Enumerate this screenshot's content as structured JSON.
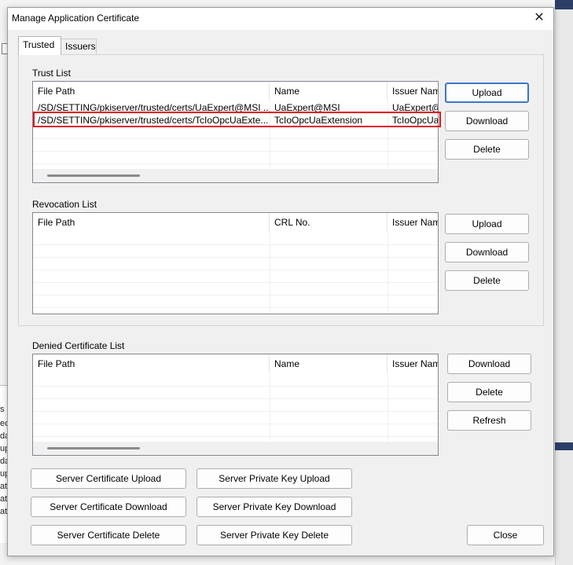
{
  "dialog": {
    "title": "Manage Application Certificate",
    "close_icon": "close-icon",
    "close_glyph": "✕"
  },
  "background": {
    "left_fragments": [
      "s",
      "ec",
      "da",
      "up",
      "da",
      "up",
      "ate",
      "ate",
      "ate"
    ]
  },
  "tabs": [
    {
      "label": "Trusted",
      "active": true
    },
    {
      "label": "Issuers",
      "active": false
    }
  ],
  "trust_list": {
    "label": "Trust List",
    "columns": [
      "File Path",
      "Name",
      "Issuer Nam"
    ],
    "rows": [
      {
        "file_path": "/SD/SETTING/pkiserver/trusted/certs/UaExpert@MSI ...",
        "name": "UaExpert@MSI",
        "issuer": "UaExpert@I"
      },
      {
        "file_path": "/SD/SETTING/pkiserver/trusted/certs/TcIoOpcUaExte...",
        "name": "TcIoOpcUaExtension",
        "issuer": "TcIoOpcUa",
        "highlighted": true
      }
    ],
    "buttons": {
      "upload": "Upload",
      "download": "Download",
      "delete": "Delete"
    }
  },
  "revocation_list": {
    "label": "Revocation List",
    "columns": [
      "File Path",
      "CRL No.",
      "Issuer Nam"
    ],
    "rows": [],
    "buttons": {
      "upload": "Upload",
      "download": "Download",
      "delete": "Delete"
    }
  },
  "denied_list": {
    "label": "Denied Certificate List",
    "columns": [
      "File Path",
      "Name",
      "Issuer Nam"
    ],
    "rows": [],
    "buttons": {
      "download": "Download",
      "delete": "Delete",
      "refresh": "Refresh"
    }
  },
  "server_buttons": {
    "cert_upload": "Server Certificate Upload",
    "key_upload": "Server Private Key Upload",
    "cert_download": "Server Certificate Download",
    "key_download": "Server Private Key Download",
    "cert_delete": "Server Certificate Delete",
    "key_delete": "Server Private Key Delete"
  },
  "close_button": "Close",
  "colors": {
    "highlight": "#e0141e",
    "default_button_border": "#3b79c6"
  }
}
